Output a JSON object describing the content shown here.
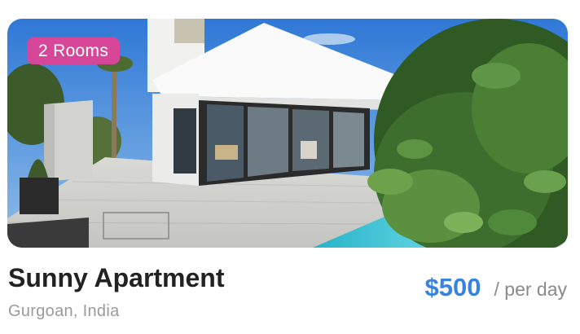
{
  "listing": {
    "image_alt": "Modern white villa with glass walls and pool",
    "badge": "2 Rooms",
    "title": "Sunny Apartment",
    "location": "Gurgoan, India",
    "price": "$500",
    "period": "/ per day"
  },
  "colors": {
    "badge_bg": "#d6479a",
    "price": "#3a82e0",
    "title": "#222222",
    "muted": "#9a9a9a"
  }
}
